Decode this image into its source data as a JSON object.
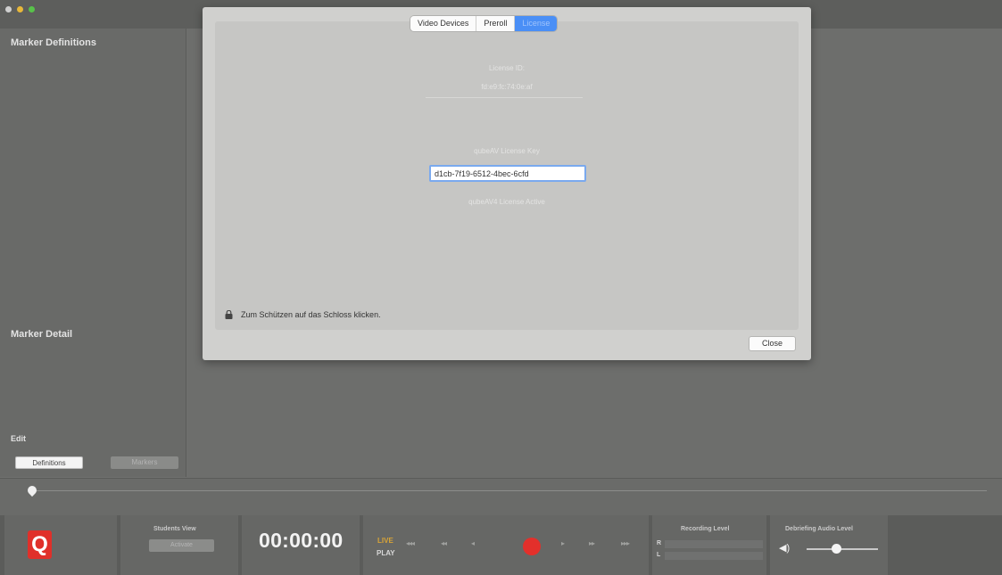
{
  "sidebar": {
    "marker_definitions_title": "Marker Definitions",
    "marker_detail_title": "Marker Detail",
    "edit_title": "Edit",
    "definitions_button": "Definitions",
    "markers_button": "Markers"
  },
  "modal": {
    "tabs": [
      {
        "label": "Video Devices",
        "active": false
      },
      {
        "label": "Preroll",
        "active": false
      },
      {
        "label": "License",
        "active": true
      }
    ],
    "license_id_label": "License ID:",
    "license_id_value": "fd:e9:fc:74:0e:af",
    "license_key_label": "qubeAV License Key",
    "license_key_value": "d1cb-7f19-6512-4bec-6cfd",
    "license_status": "qubeAV4 License Active",
    "lock_text": "Zum Schützen auf das Schloss klicken.",
    "close_button": "Close"
  },
  "bottombar": {
    "logo": "Q",
    "students_view_label": "Students View",
    "activate_button": "Activate",
    "timecode": "00:00:00",
    "live_label": "LIVE",
    "play_label": "PLAY",
    "transport": [
      "◂◂◂",
      "◂◂",
      "◂",
      "record",
      "▸",
      "▸▸",
      "▸▸▸"
    ],
    "recording_level_label": "Recording Level",
    "channel_r": "R",
    "channel_l": "L",
    "debriefing_audio_label": "Debriefing Audio Level",
    "debriefing_audio_level": 0.35
  },
  "colors": {
    "accent": "#4a8ff6",
    "record": "#e3302b",
    "logo": "#e0302a",
    "live": "#d8a437"
  },
  "icons": [
    "lock-icon",
    "record-icon",
    "speaker-icon",
    "playhead-icon",
    "q-logo"
  ]
}
